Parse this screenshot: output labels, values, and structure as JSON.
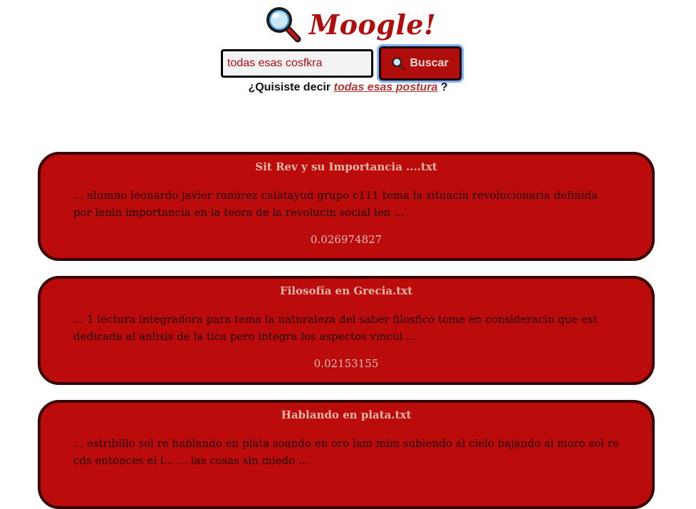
{
  "logo": {
    "text": "Moogle!",
    "icon": "magnifying-glass-icon"
  },
  "search": {
    "value": "todas esas cosfkra",
    "button_icon": "magnifying-glass-icon",
    "button_label": "Buscar"
  },
  "suggestion": {
    "prefix": "¿Quisiste decir",
    "query": "todas esas postura",
    "suffix": "?"
  },
  "results": [
    {
      "title": "Sit Rev y su Importancia ....txt",
      "snippet": "... alumno leonardo javier ramirez calatayud grupo c111 tema la situacin revolucionaria definida por lenin importancia en la teora de la revolucin social len ...",
      "score": "0.026974827"
    },
    {
      "title": "Filosofía en Grecia.txt",
      "snippet": "... 1 lectura integradora para tema la naturaleza del saber filosfico tome en consideracin que est dedicada al anlisis de la tica pero integra los aspectos vincul ...",
      "score": "0.02153155"
    },
    {
      "title": "Hablando en plata.txt",
      "snippet": "... estribillo sol re hablando en plata soando en oro lam mim subiendo al cielo bajando al moro sol re cds entonces el i... ... las cosas sin miedo ...",
      "score": ""
    }
  ],
  "colors": {
    "brand_red": "#b00d0d",
    "card_red": "#bb0b0b",
    "card_border": "#3a0303",
    "focus_ring": "#7fb2ff"
  }
}
